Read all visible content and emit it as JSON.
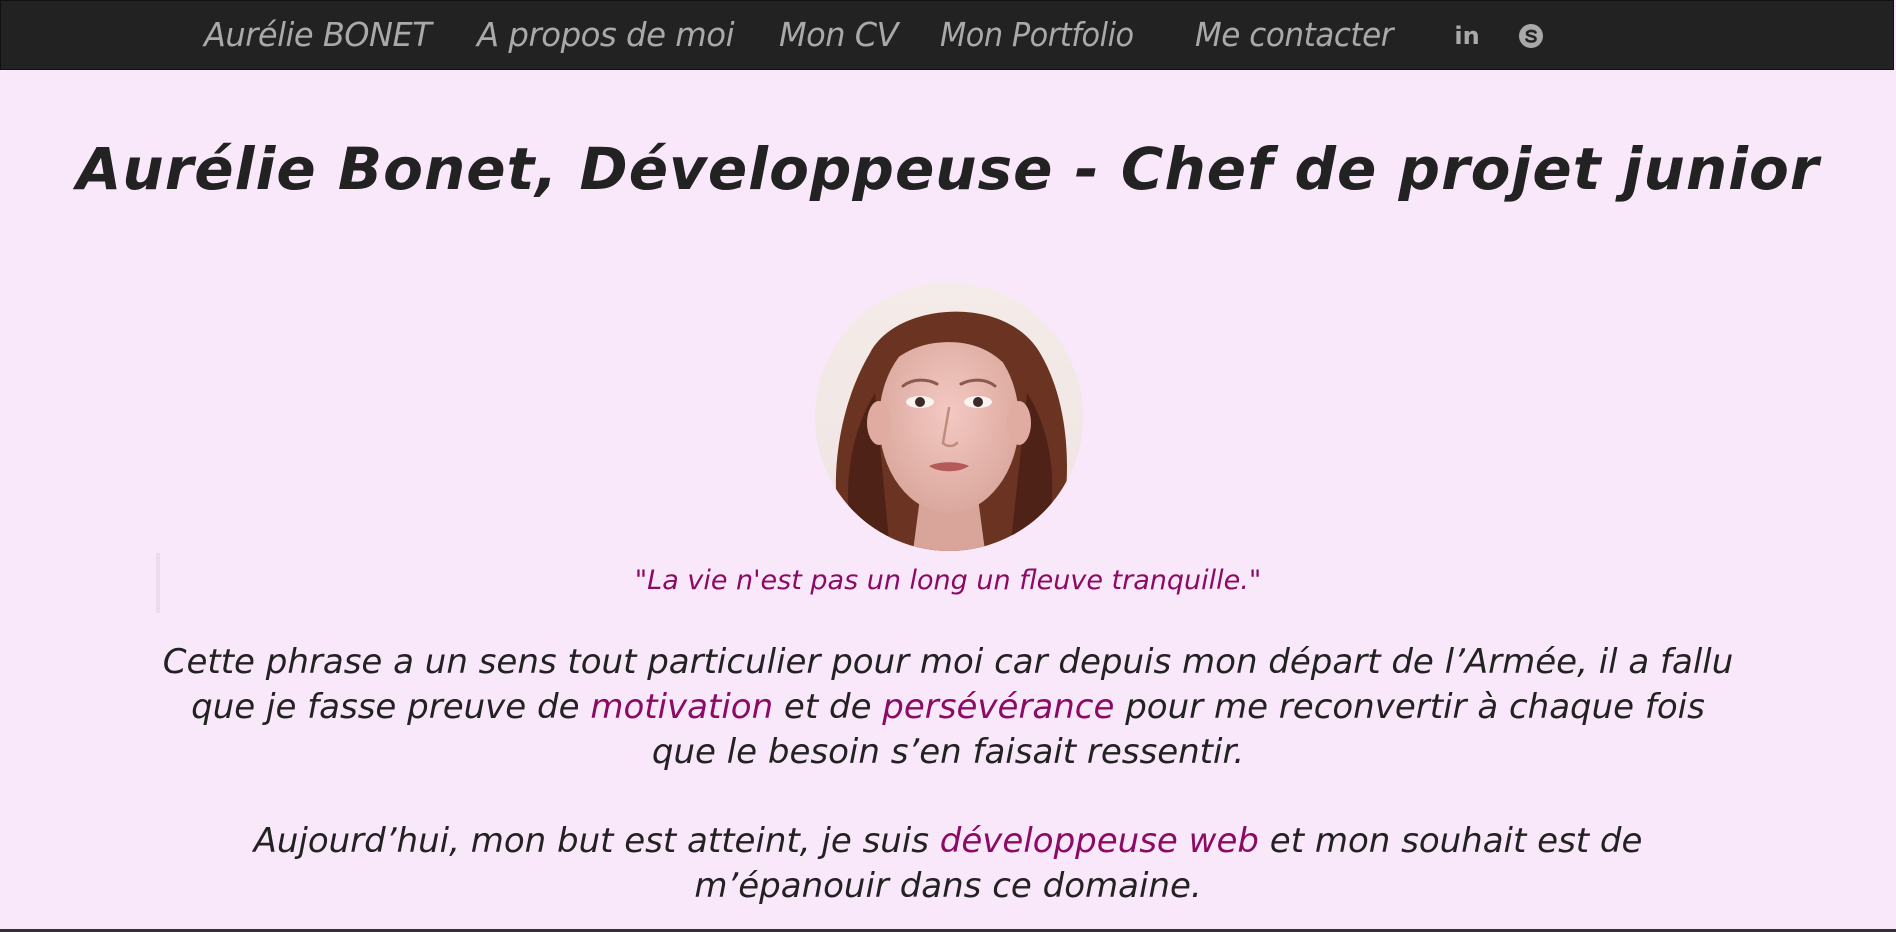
{
  "nav": {
    "brand": "Aurélie BONET",
    "items": [
      {
        "label": "A propos de moi"
      },
      {
        "label": "Mon CV"
      },
      {
        "label": "Mon Portfolio"
      },
      {
        "label": "Me contacter"
      }
    ],
    "icons": [
      "linkedin-icon",
      "skype-icon"
    ],
    "linkedin_glyph": "in",
    "background": "#222222",
    "text_color": "#a9a9a9"
  },
  "header": {
    "title": "Aurélie Bonet, Développeuse - Chef de projet junior"
  },
  "quote": "\"La vie n'est pas un long un fleuve tranquille.\"",
  "paragraph1": {
    "part1": "Cette phrase a un sens tout particulier pour moi car depuis mon départ de l’Armée, il a fallu que je fasse preuve de ",
    "highlight1": "motivation",
    "part2": " et de ",
    "highlight2": "persévérance",
    "part3": " pour me reconvertir à chaque fois que le besoin s’en faisait ressentir."
  },
  "paragraph2": {
    "part1": "Aujourd’hui, mon but est atteint, je suis ",
    "highlight1": "développeuse web",
    "part2": " et mon souhait est de m’épanouir dans ce domaine."
  },
  "colors": {
    "page_background": "#f9e8f9",
    "accent": "#8b0a64",
    "text": "#222222"
  }
}
